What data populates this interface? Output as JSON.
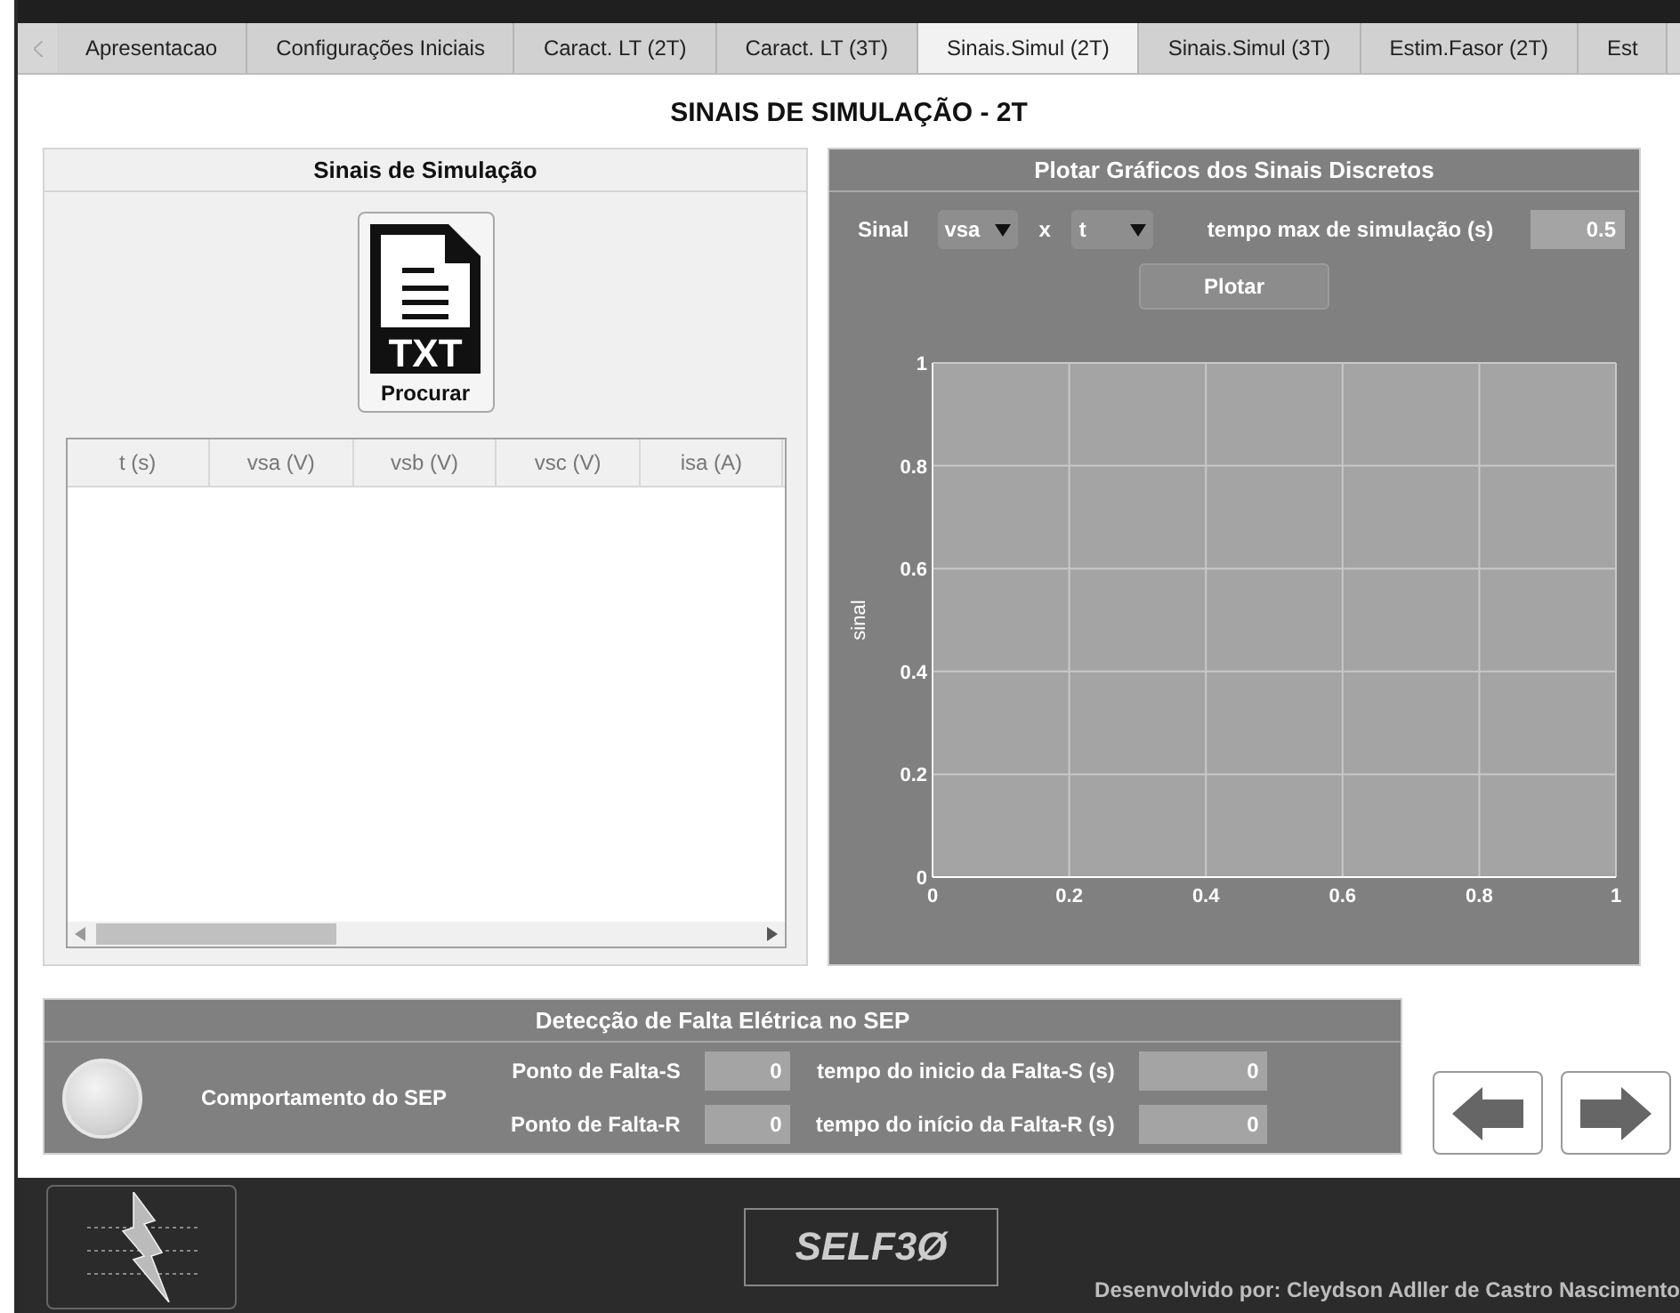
{
  "tabs": [
    {
      "label": "Apresentacao",
      "selected": false
    },
    {
      "label": "Configurações Iniciais",
      "selected": false
    },
    {
      "label": "Caract. LT (2T)",
      "selected": false
    },
    {
      "label": "Caract. LT (3T)",
      "selected": false
    },
    {
      "label": "Sinais.Simul (2T)",
      "selected": true
    },
    {
      "label": "Sinais.Simul (3T)",
      "selected": false
    },
    {
      "label": "Estim.Fasor (2T)",
      "selected": false
    },
    {
      "label": "Est",
      "selected": false
    }
  ],
  "page_title": "SINAIS DE SIMULAÇÃO - 2T",
  "signals_panel": {
    "title": "Sinais de Simulação",
    "browse_button": {
      "icon_text": "TXT",
      "label": "Procurar"
    },
    "table": {
      "columns": [
        "t (s)",
        "vsa (V)",
        "vsb (V)",
        "vsc (V)",
        "isa (A)"
      ]
    }
  },
  "plot_panel": {
    "title": "Plotar Gráficos dos Sinais Discretos",
    "signal_label": "Sinal",
    "signal_value": "vsa",
    "x_label": "x",
    "x_value": "t",
    "tmax_label": "tempo max de simulação (s)",
    "tmax_value": "0.5",
    "plot_button": "Plotar",
    "chart_data": {
      "type": "line",
      "grid": true,
      "ylabel": "sinal",
      "xlim": [
        0,
        1
      ],
      "ylim": [
        0,
        1
      ],
      "xticks": [
        0,
        0.2,
        0.4,
        0.6,
        0.8,
        1
      ],
      "yticks": [
        0,
        0.2,
        0.4,
        0.6,
        0.8,
        1
      ]
    }
  },
  "fault_panel": {
    "title": "Detecção de Falta Elétrica no SEP",
    "lamp_label": "Comportamento do SEP",
    "fields": [
      {
        "label": "Ponto de Falta-S",
        "value": "0",
        "time_label": "tempo do inicio da Falta-S (s)",
        "time_value": "0"
      },
      {
        "label": "Ponto de Falta-R",
        "value": "0",
        "time_label": "tempo do início da Falta-R (s)",
        "time_value": "0"
      }
    ]
  },
  "footer": {
    "brand": "SELF3Ø",
    "credit": "Desenvolvido por: Cleydson Adller de Castro Nascimento"
  }
}
